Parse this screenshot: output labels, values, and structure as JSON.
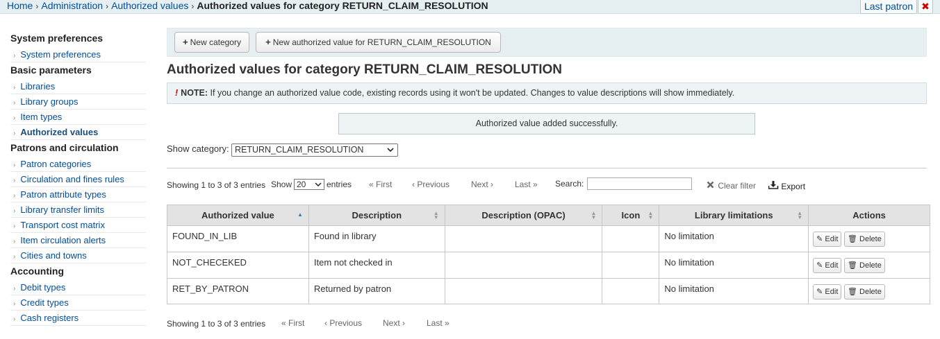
{
  "breadcrumbs": {
    "home": "Home",
    "administration": "Administration",
    "authorized_values": "Authorized values",
    "current": "Authorized values for category RETURN_CLAIM_RESOLUTION",
    "separator": "›"
  },
  "last_patron": {
    "label": "Last patron",
    "close": "✖"
  },
  "sidebar": {
    "sections": [
      {
        "heading": "System preferences",
        "items": [
          "System preferences"
        ]
      },
      {
        "heading": "Basic parameters",
        "items": [
          "Libraries",
          "Library groups",
          "Item types",
          "Authorized values"
        ]
      },
      {
        "heading": "Patrons and circulation",
        "items": [
          "Patron categories",
          "Circulation and fines rules",
          "Patron attribute types",
          "Library transfer limits",
          "Transport cost matrix",
          "Item circulation alerts",
          "Cities and towns"
        ]
      },
      {
        "heading": "Accounting",
        "items": [
          "Debit types",
          "Credit types",
          "Cash registers"
        ]
      }
    ],
    "active_item": "Authorized values",
    "arrow": "›"
  },
  "toolbar": {
    "new_category": "New category",
    "new_value": "New authorized value for RETURN_CLAIM_RESOLUTION",
    "plus_icon": "+"
  },
  "page_title": "Authorized values for category RETURN_CLAIM_RESOLUTION",
  "note": {
    "icon": "!",
    "label": "NOTE:",
    "text": "If you change an authorized value code, existing records using it won't be updated. Changes to value descriptions will show immediately."
  },
  "success_message": "Authorized value added successfully.",
  "category_filter": {
    "label": "Show category:",
    "selected": "RETURN_CLAIM_RESOLUTION"
  },
  "table_controls": {
    "info": "Showing 1 to 3 of 3 entries",
    "show_label": "Show",
    "page_length": "20",
    "entries_label": "entries",
    "first": "« First",
    "previous": "‹ Previous",
    "next": "Next ›",
    "last": "Last »",
    "search_label": "Search:",
    "search_value": "",
    "clear_filter": "Clear filter",
    "export": "Export"
  },
  "table": {
    "columns": [
      "Authorized value",
      "Description",
      "Description (OPAC)",
      "Icon",
      "Library limitations",
      "Actions"
    ],
    "rows": [
      {
        "value": "FOUND_IN_LIB",
        "description": "Found in library",
        "description_opac": "",
        "icon": "",
        "limitations": "No limitation"
      },
      {
        "value": "NOT_CHECEKED",
        "description": "Item not checked in",
        "description_opac": "",
        "icon": "",
        "limitations": "No limitation"
      },
      {
        "value": "RET_BY_PATRON",
        "description": "Returned by patron",
        "description_opac": "",
        "icon": "",
        "limitations": "No limitation"
      }
    ],
    "edit_label": "Edit",
    "delete_label": "Delete"
  },
  "bottom_controls": {
    "info": "Showing 1 to 3 of 3 entries",
    "first": "« First",
    "previous": "‹ Previous",
    "next": "Next ›",
    "last": "Last »"
  },
  "colors": {
    "link": "#004d99",
    "header_bg": "#e6f0f2",
    "table_header": "#e3e3e3",
    "danger": "#cc0000"
  }
}
